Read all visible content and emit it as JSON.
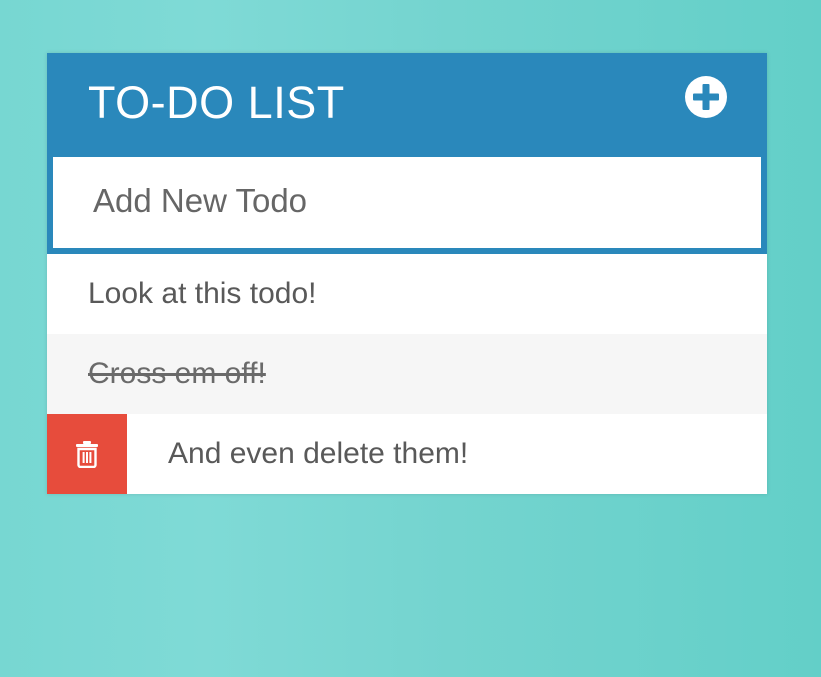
{
  "header": {
    "title": "TO-DO LIST",
    "add_icon": "plus-circle-icon"
  },
  "new_todo": {
    "placeholder": "Add New Todo",
    "value": ""
  },
  "todos": [
    {
      "text": "Look at this todo!",
      "completed": false
    },
    {
      "text": "Cross em off!",
      "completed": true
    },
    {
      "text": "And even delete them!",
      "completed": false,
      "delete_visible": true
    }
  ],
  "delete_icon": "trash-icon",
  "colors": {
    "header": "#2a88bb",
    "delete": "#e74c3c",
    "background_start": "#77d7d2",
    "background_end": "#63cfc8"
  }
}
